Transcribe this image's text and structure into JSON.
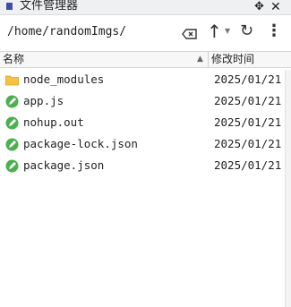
{
  "window": {
    "title": "文件管理器",
    "pin_icon": "pin-icon",
    "close_icon": "close-icon"
  },
  "toolbar": {
    "path": "/home/randomImgs/",
    "clear_icon": "clear-input-icon",
    "up_icon": "arrow-up-icon",
    "up_glyph": "↑",
    "dropdown_glyph": "▼",
    "refresh_glyph": "↻",
    "menu_glyph": "⋮"
  },
  "columns": {
    "name": "名称",
    "modified": "修改时间",
    "sort_glyph": "▲"
  },
  "files": [
    {
      "name": "node_modules",
      "date": "2025/01/21",
      "type": "folder"
    },
    {
      "name": "app.js",
      "date": "2025/01/21",
      "type": "file"
    },
    {
      "name": "nohup.out",
      "date": "2025/01/21",
      "type": "file"
    },
    {
      "name": "package-lock.json",
      "date": "2025/01/21",
      "type": "file"
    },
    {
      "name": "package.json",
      "date": "2025/01/21",
      "type": "file"
    }
  ],
  "colors": {
    "folder": "#f5c242",
    "file": "#4caf50",
    "title_icon": "#3a4fa8"
  }
}
